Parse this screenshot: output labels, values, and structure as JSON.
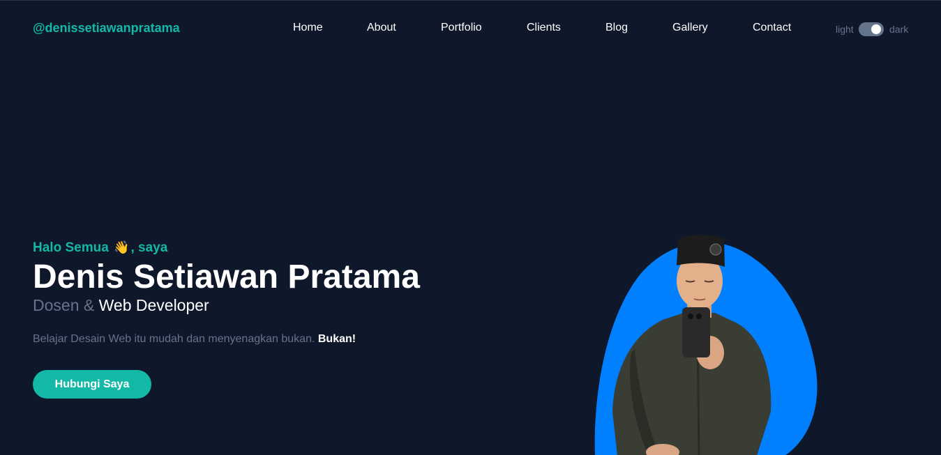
{
  "brand": "@denissetiawanpratama",
  "nav": {
    "home": "Home",
    "about": "About",
    "portfolio": "Portfolio",
    "clients": "Clients",
    "blog": "Blog",
    "gallery": "Gallery",
    "contact": "Contact"
  },
  "theme_toggle": {
    "light_label": "light",
    "dark_label": "dark",
    "state": "dark"
  },
  "hero": {
    "greeting_prefix": "Halo Semua",
    "greeting_emoji": "👋",
    "greeting_suffix": ", saya",
    "name": "Denis Setiawan Pratama",
    "role_secondary": "Dosen &",
    "role_primary": "Web Developer",
    "description": "Belajar Desain Web itu mudah dan menyenagkan bukan.",
    "description_emphasis": "Bukan!",
    "cta_label": "Hubungi Saya"
  },
  "colors": {
    "background": "#0f172a",
    "primary": "#14b8a6",
    "muted": "#64748b",
    "portrait_blob": "#0080ff"
  }
}
